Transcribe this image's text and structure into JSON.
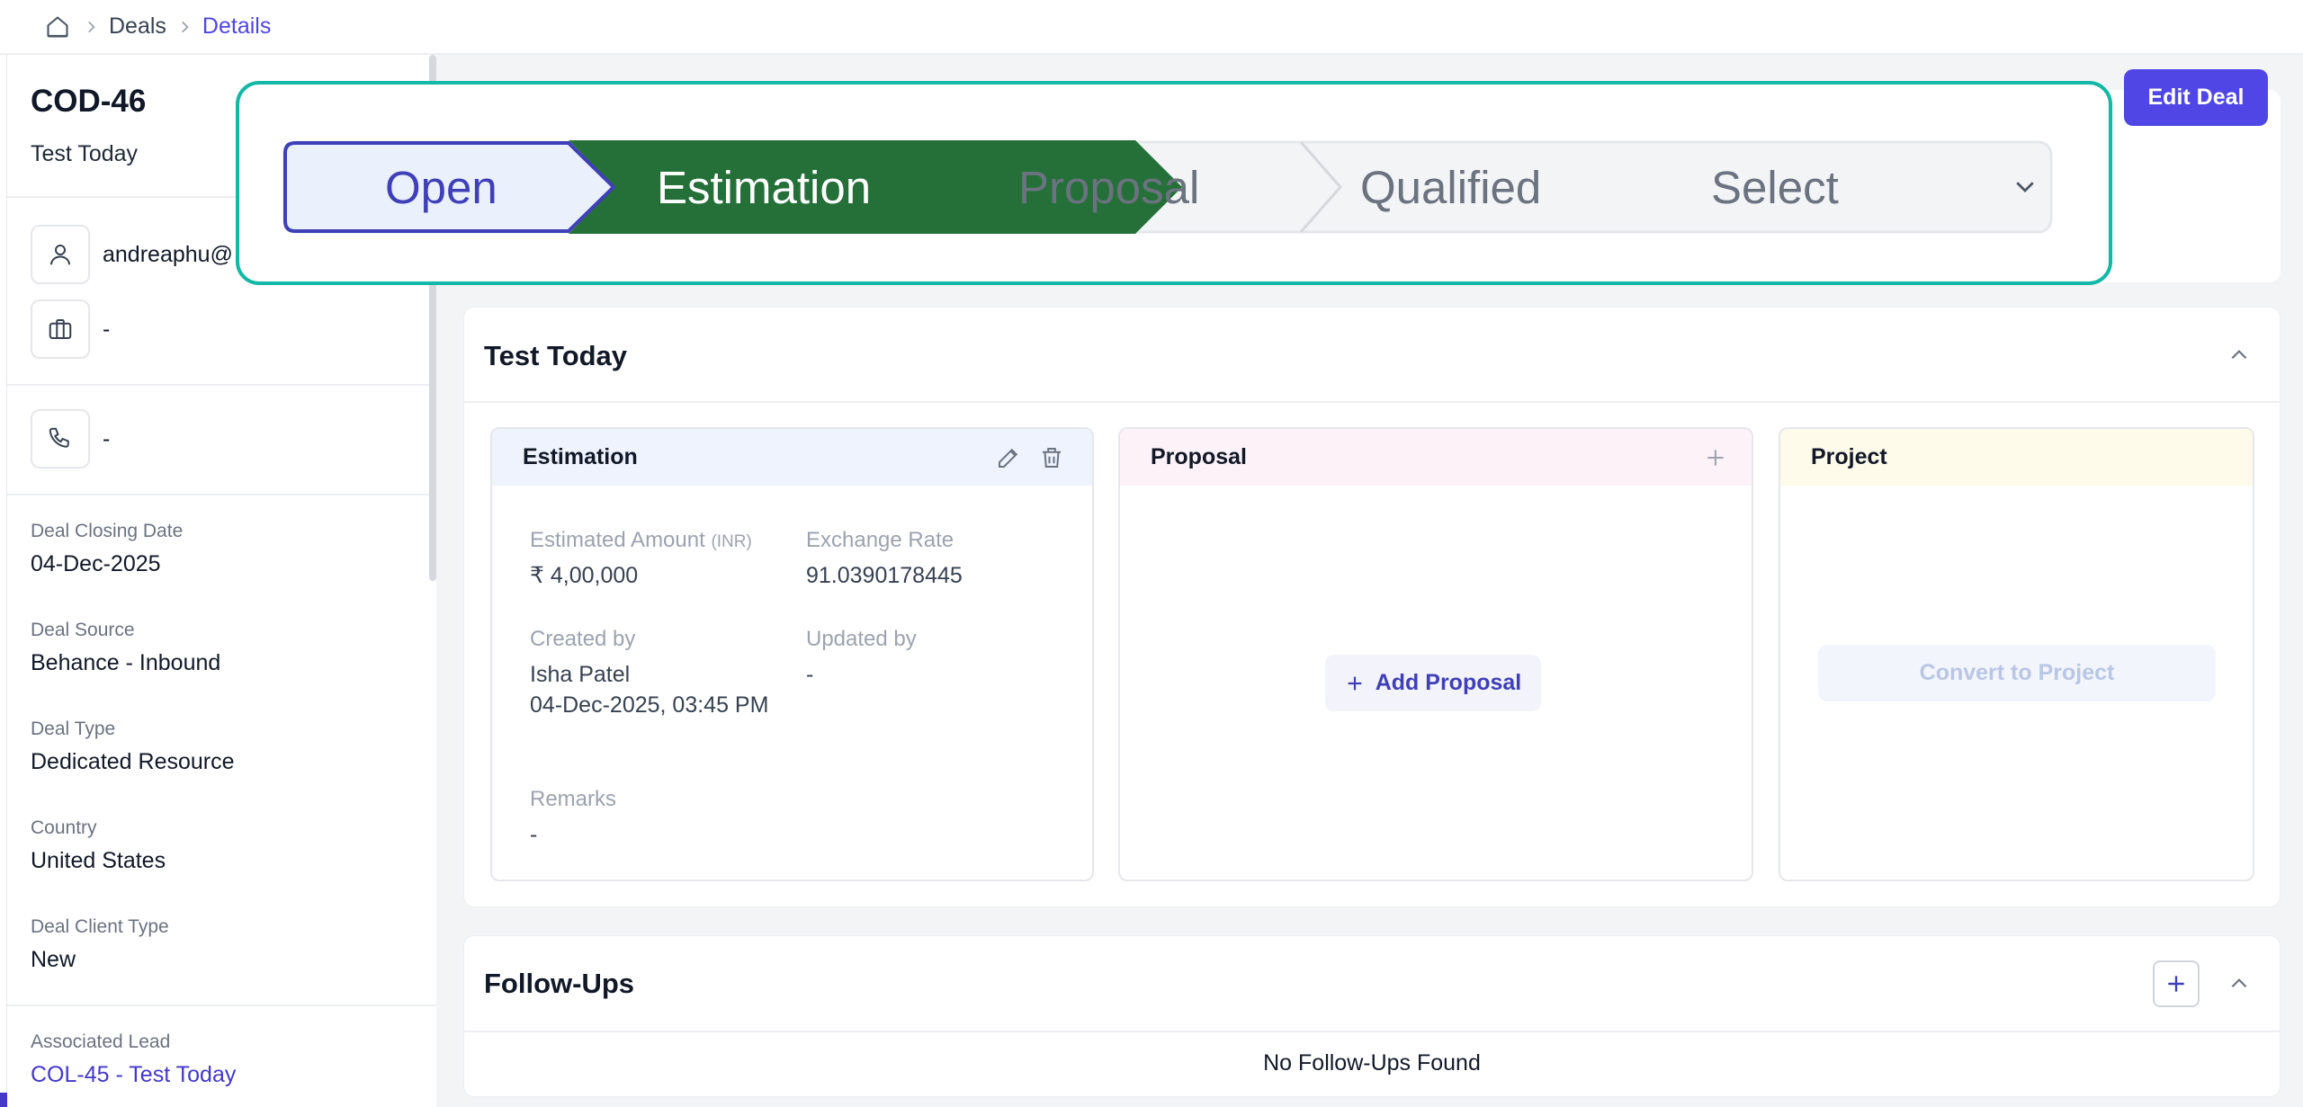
{
  "breadcrumb": {
    "items": [
      "Deals",
      "Details"
    ],
    "home_icon": "home-icon"
  },
  "sidebar": {
    "deal_code": "COD-46",
    "deal_name": "Test Today",
    "email": "andreaphu@",
    "company": "-",
    "phone": "-",
    "fields": [
      {
        "label": "Deal Closing Date",
        "value": "04-Dec-2025"
      },
      {
        "label": "Deal Source",
        "value": "Behance - Inbound"
      },
      {
        "label": "Deal Type",
        "value": "Dedicated Resource"
      },
      {
        "label": "Country",
        "value": "United States"
      },
      {
        "label": "Deal Client Type",
        "value": "New"
      },
      {
        "label": "Associated Lead",
        "value": "COL-45 - Test Today"
      }
    ]
  },
  "header": {
    "edit_label": "Edit Deal"
  },
  "stages": {
    "items": [
      "Open",
      "Estimation",
      "Proposal",
      "Qualified",
      "Select"
    ],
    "selected": "Open",
    "current": "Estimation",
    "colors": {
      "open_bg": "#eaf0fc",
      "open_border": "#3f3fb8",
      "current_bg": "#257038",
      "inactive_bg": "#f3f4f6",
      "overlay_border": "#14b8a6"
    }
  },
  "deal_section": {
    "title": "Test Today",
    "estimation": {
      "title": "Estimation",
      "amount_label": "Estimated Amount",
      "amount_unit": "(INR)",
      "amount_value": "₹ 4,00,000",
      "rate_label": "Exchange Rate",
      "rate_value": "91.0390178445",
      "created_label": "Created by",
      "created_name": "Isha Patel",
      "created_date": "04-Dec-2025, 03:45 PM",
      "updated_label": "Updated by",
      "updated_value": "-",
      "remarks_label": "Remarks",
      "remarks_value": "-"
    },
    "proposal": {
      "title": "Proposal",
      "add_label": "Add Proposal"
    },
    "project": {
      "title": "Project",
      "convert_label": "Convert to Project"
    }
  },
  "followups": {
    "title": "Follow-Ups",
    "empty_text": "No Follow-Ups Found"
  }
}
